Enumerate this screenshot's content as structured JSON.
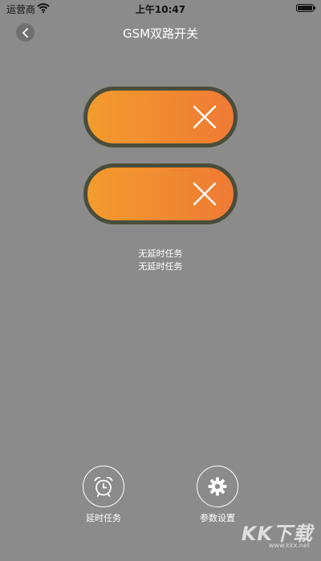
{
  "status_bar": {
    "carrier": "运营商",
    "time": "上午10:47"
  },
  "header": {
    "title": "GSM双路开关"
  },
  "switches": [
    {
      "state": "off",
      "icon": "close-icon"
    },
    {
      "state": "off",
      "icon": "close-icon"
    }
  ],
  "tasks": {
    "line1": "无延时任务",
    "line2": "无延时任务"
  },
  "bottom_bar": {
    "timer_label": "延时任务",
    "settings_label": "参数设置"
  },
  "watermark": {
    "text": "KK下载",
    "url": "www.kkx.net"
  },
  "colors": {
    "background": "#8a8b8a",
    "switch_start": "#f29c2e",
    "switch_end": "#ef7a35",
    "switch_border": "#4a4d3a"
  }
}
